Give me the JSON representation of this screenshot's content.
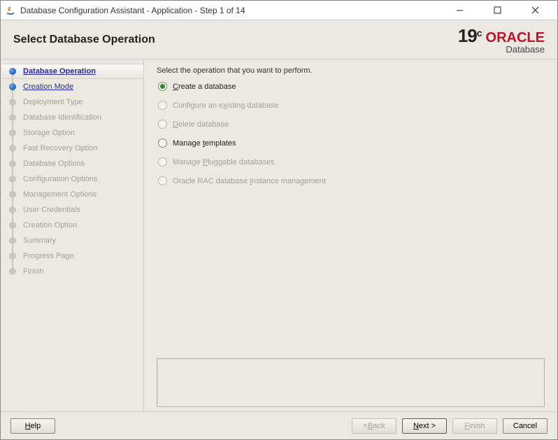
{
  "window": {
    "title": "Database Configuration Assistant - Application - Step 1 of 14"
  },
  "header": {
    "heading": "Select Database Operation",
    "brand_version": "19",
    "brand_version_suffix": "c",
    "brand_name": "ORACLE",
    "brand_sub": "Database"
  },
  "steps": [
    {
      "label": "Database Operation",
      "state": "active"
    },
    {
      "label": "Creation Mode",
      "state": "done"
    },
    {
      "label": "Deployment Type",
      "state": "future"
    },
    {
      "label": "Database Identification",
      "state": "future"
    },
    {
      "label": "Storage Option",
      "state": "future"
    },
    {
      "label": "Fast Recovery Option",
      "state": "future"
    },
    {
      "label": "Database Options",
      "state": "future"
    },
    {
      "label": "Configuration Options",
      "state": "future"
    },
    {
      "label": "Management Options",
      "state": "future"
    },
    {
      "label": "User Credentials",
      "state": "future"
    },
    {
      "label": "Creation Option",
      "state": "future"
    },
    {
      "label": "Summary",
      "state": "future"
    },
    {
      "label": "Progress Page",
      "state": "future"
    },
    {
      "label": "Finish",
      "state": "future"
    }
  ],
  "content": {
    "prompt": "Select the operation that you want to perform.",
    "options": [
      {
        "pre": "",
        "mn": "C",
        "post": "reate a database",
        "selected": true,
        "enabled": true
      },
      {
        "pre": "Configure an e",
        "mn": "x",
        "post": "isting database",
        "selected": false,
        "enabled": false
      },
      {
        "pre": "",
        "mn": "D",
        "post": "elete database",
        "selected": false,
        "enabled": false
      },
      {
        "pre": "Manage ",
        "mn": "t",
        "post": "emplates",
        "selected": false,
        "enabled": true
      },
      {
        "pre": "Manage ",
        "mn": "P",
        "post": "luggable databases",
        "selected": false,
        "enabled": false
      },
      {
        "pre": "Oracle RAC database ",
        "mn": "I",
        "post": "nstance management",
        "selected": false,
        "enabled": false
      }
    ]
  },
  "footer": {
    "help": "Help",
    "back_pre": "< ",
    "back_mn": "B",
    "back_post": "ack",
    "next_pre": "",
    "next_mn": "N",
    "next_post": "ext >",
    "finish_pre": "",
    "finish_mn": "F",
    "finish_post": "inish",
    "cancel": "Cancel"
  }
}
